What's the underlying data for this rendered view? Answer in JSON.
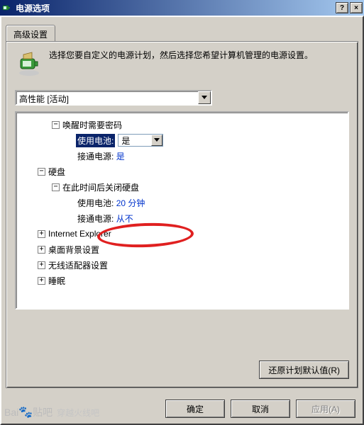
{
  "window": {
    "title": "电源选项",
    "help_symbol": "?",
    "close_symbol": "×"
  },
  "tab": {
    "label": "高级设置"
  },
  "intro": {
    "text": "选择您要自定义的电源计划，然后选择您希望计算机管理的电源设置。"
  },
  "plan_selector": {
    "value": "高性能 [活动]"
  },
  "tree": {
    "wake_password": {
      "label": "唤醒时需要密码",
      "on_battery_label": "使用电池:",
      "on_battery_value": "是",
      "plugged_label": "接通电源:",
      "plugged_value": "是"
    },
    "hdd": {
      "label": "硬盘",
      "turn_off_label": "在此时间后关闭硬盘",
      "on_battery_label": "使用电池:",
      "on_battery_value": "20 分钟",
      "plugged_label": "接通电源:",
      "plugged_value": "从不"
    },
    "ie": {
      "label": "Internet Explorer"
    },
    "desktop_bg": {
      "label": "桌面背景设置"
    },
    "wireless": {
      "label": "无线适配器设置"
    },
    "sleep": {
      "label": "睡眠"
    }
  },
  "buttons": {
    "restore_defaults": "还原计划默认值(R)",
    "ok": "确定",
    "cancel": "取消",
    "apply": "应用(A)"
  },
  "watermark": {
    "brand": "Bai",
    "brand2": "贴吧",
    "sub": "穿越火线吧"
  }
}
